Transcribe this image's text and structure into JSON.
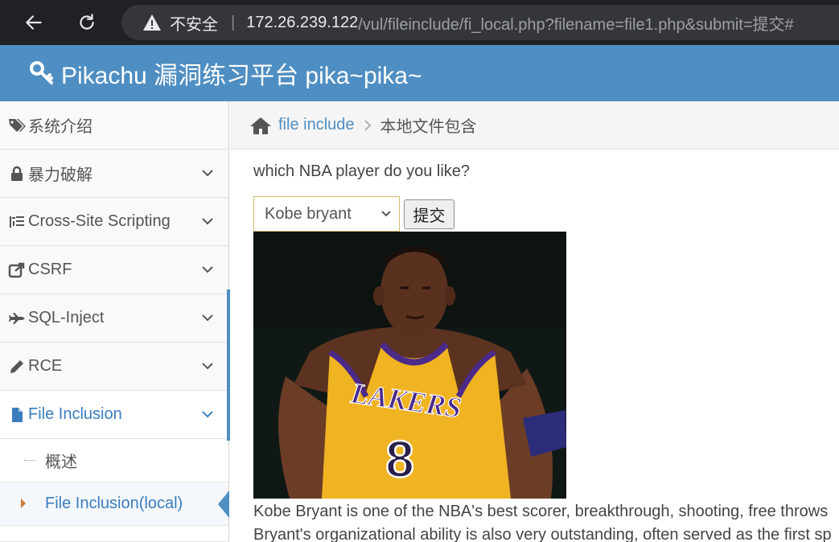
{
  "browser": {
    "security_label": "不安全",
    "url_host": "172.26.239.122",
    "url_path": "/vul/fileinclude/fi_local.php?filename=file1.php&submit=提交#"
  },
  "site": {
    "title": "Pikachu 漏洞练习平台 pika~pika~",
    "header_color": "#4f8ec2"
  },
  "sidebar": {
    "items": [
      {
        "label": "系统介绍",
        "icon": "tags-icon"
      },
      {
        "label": "暴力破解",
        "icon": "lock-icon"
      },
      {
        "label": "Cross-Site Scripting",
        "icon": "list-icon"
      },
      {
        "label": "CSRF",
        "icon": "share-icon"
      },
      {
        "label": "SQL-Inject",
        "icon": "plane-icon"
      },
      {
        "label": "RCE",
        "icon": "pencil-icon"
      },
      {
        "label": "File Inclusion",
        "icon": "file-icon"
      }
    ],
    "sub_items": [
      {
        "label": "概述"
      },
      {
        "label": "File Inclusion(local)"
      }
    ]
  },
  "breadcrumb": {
    "parent": "file include",
    "current": "本地文件包含"
  },
  "main": {
    "question": "which NBA player do you like?",
    "select_value": "Kobe bryant",
    "submit_label": "提交",
    "jersey_text": "LAKERS",
    "jersey_number": "8",
    "caption_line1": "Kobe Bryant is one of the NBA's best scorer, breakthrough, shooting, free throws",
    "caption_line2": "Bryant's organizational ability is also very outstanding, often served as the first sp"
  }
}
